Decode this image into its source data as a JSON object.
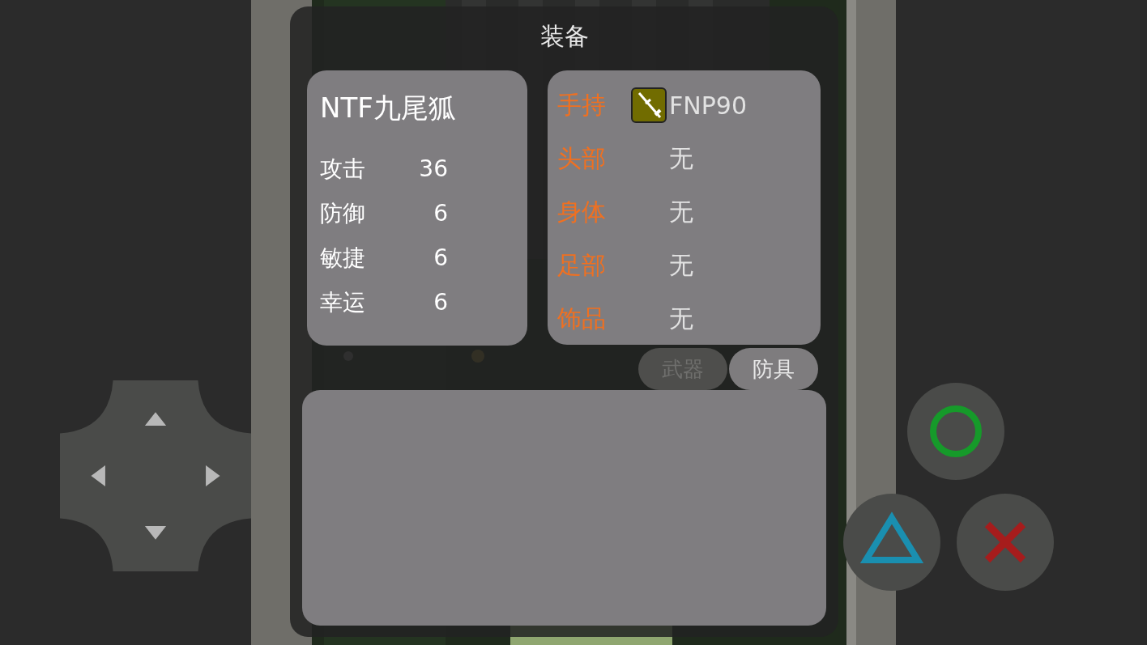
{
  "title": "装备",
  "character": {
    "name": "NTF九尾狐",
    "stats": [
      {
        "label": "攻击",
        "value": "36"
      },
      {
        "label": "防御",
        "value": "6"
      },
      {
        "label": "敏捷",
        "value": "6"
      },
      {
        "label": "幸运",
        "value": "6"
      }
    ]
  },
  "slots": [
    {
      "label": "手持",
      "value": "FNP90",
      "kind": "weapon"
    },
    {
      "label": "头部",
      "value": "无",
      "kind": "empty"
    },
    {
      "label": "身体",
      "value": "无",
      "kind": "empty"
    },
    {
      "label": "足部",
      "value": "无",
      "kind": "empty"
    },
    {
      "label": "饰品",
      "value": "无",
      "kind": "empty"
    }
  ],
  "tabs": [
    {
      "label": "武器",
      "selected": false
    },
    {
      "label": "防具",
      "selected": true
    }
  ],
  "action_buttons": [
    {
      "kind": "circle"
    },
    {
      "kind": "triangle"
    },
    {
      "kind": "cross"
    }
  ]
}
